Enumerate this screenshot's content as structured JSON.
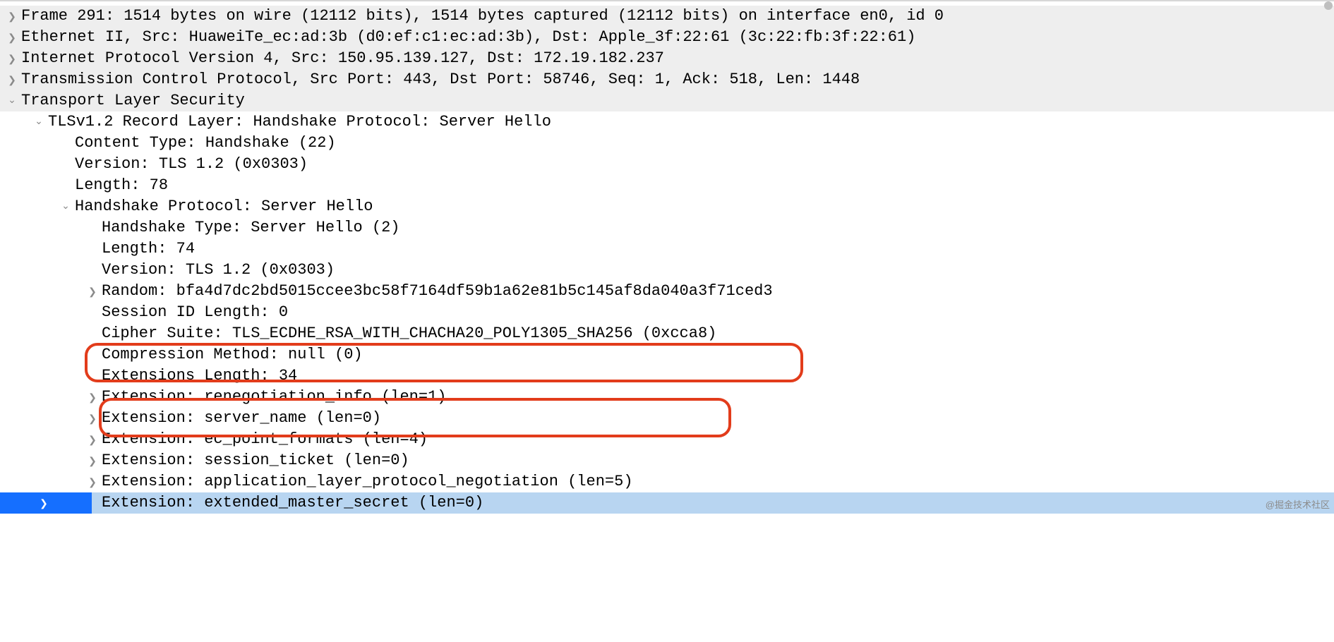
{
  "rows": {
    "frame": "Frame 291: 1514 bytes on wire (12112 bits), 1514 bytes captured (12112 bits) on interface en0, id 0",
    "eth": "Ethernet II, Src: HuaweiTe_ec:ad:3b (d0:ef:c1:ec:ad:3b), Dst: Apple_3f:22:61 (3c:22:fb:3f:22:61)",
    "ip": "Internet Protocol Version 4, Src: 150.95.139.127, Dst: 172.19.182.237",
    "tcp": "Transmission Control Protocol, Src Port: 443, Dst Port: 58746, Seq: 1, Ack: 518, Len: 1448",
    "tls": "Transport Layer Security",
    "record": "TLSv1.2 Record Layer: Handshake Protocol: Server Hello",
    "ctype": "Content Type: Handshake (22)",
    "ver1": "Version: TLS 1.2 (0x0303)",
    "len1": "Length: 78",
    "hs": "Handshake Protocol: Server Hello",
    "hstype": "Handshake Type: Server Hello (2)",
    "len2": "Length: 74",
    "ver2": "Version: TLS 1.2 (0x0303)",
    "random": "Random: bfa4d7dc2bd5015ccee3bc58f7164df59b1a62e81b5c145af8da040a3f71ced3",
    "sidlen": "Session ID Length: 0",
    "cipher": "Cipher Suite: TLS_ECDHE_RSA_WITH_CHACHA20_POLY1305_SHA256 (0xcca8)",
    "compr": "Compression Method: null (0)",
    "extlen": "Extensions Length: 34",
    "ext1": "Extension: renegotiation_info (len=1)",
    "ext2": "Extension: server_name (len=0)",
    "ext3": "Extension: ec_point_formats (len=4)",
    "ext4": "Extension: session_ticket (len=0)",
    "ext5": "Extension: application_layer_protocol_negotiation (len=5)",
    "ext6": "Extension: extended_master_secret (len=0)"
  },
  "watermark": "@掘金技术社区"
}
